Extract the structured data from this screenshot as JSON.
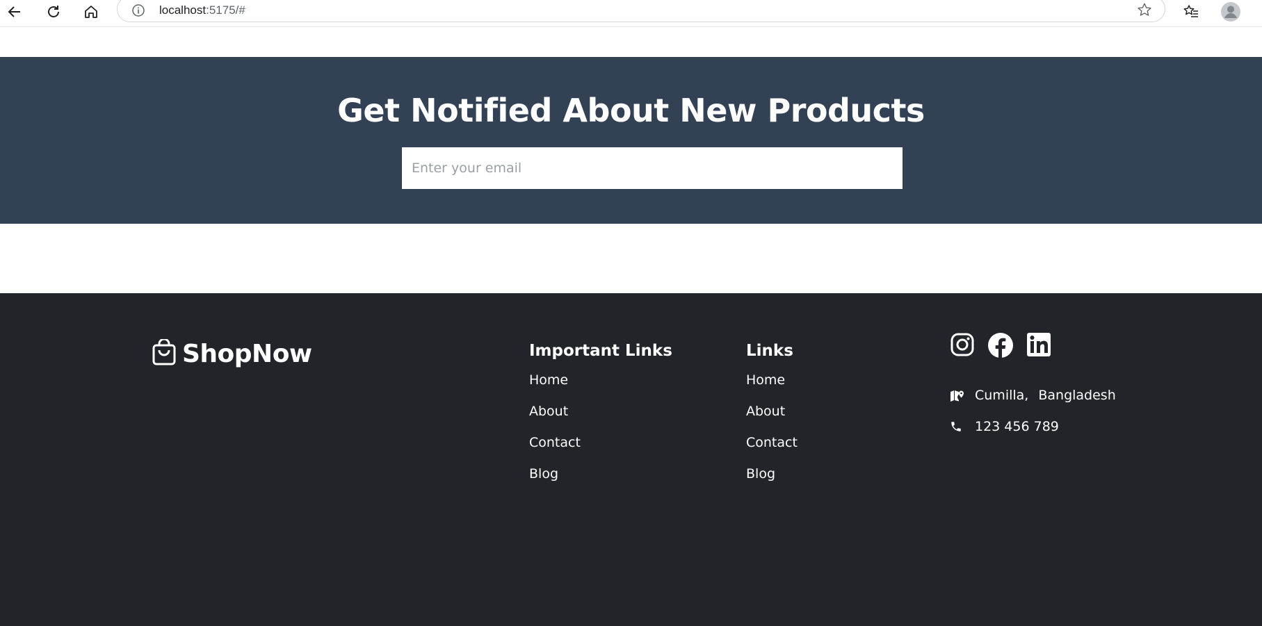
{
  "browser": {
    "url_host": "localhost",
    "url_rest": ":5175/#"
  },
  "newsletter": {
    "title": "Get Notified About New Products",
    "placeholder": "Enter your email",
    "bg_color": "#334155"
  },
  "footer": {
    "bg_color": "#212429",
    "brand": "ShopNow",
    "important_links": {
      "heading": "Important Links",
      "items": [
        "Home",
        "About",
        "Contact",
        "Blog"
      ]
    },
    "links": {
      "heading": "Links",
      "items": [
        "Home",
        "About",
        "Contact",
        "Blog"
      ]
    },
    "social_icons": [
      "instagram-icon",
      "facebook-icon",
      "linkedin-icon"
    ],
    "contact": {
      "city": "Cumilla,",
      "country": "Bangladesh",
      "phone": "123 456 789"
    }
  }
}
